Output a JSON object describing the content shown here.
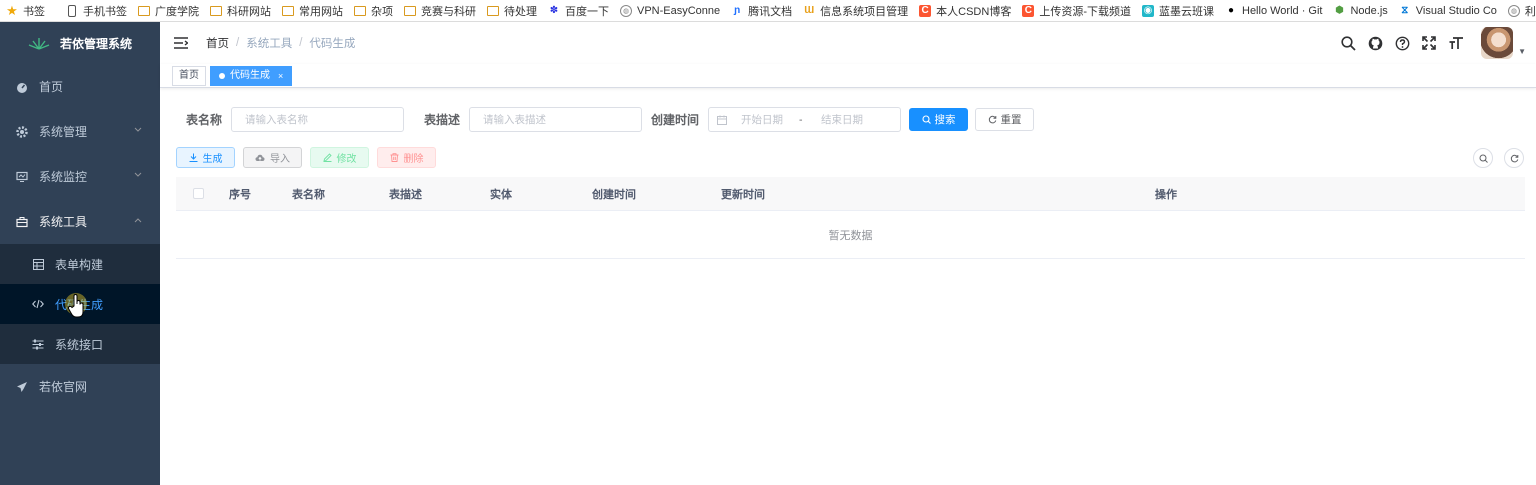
{
  "bookmarks": [
    {
      "label": "书签",
      "icon": "star-icon"
    },
    {
      "label": "手机书签",
      "icon": "phone-icon"
    },
    {
      "label": "广度学院",
      "icon": "folder-icon"
    },
    {
      "label": "科研网站",
      "icon": "folder-icon"
    },
    {
      "label": "常用网站",
      "icon": "folder-icon"
    },
    {
      "label": "杂项",
      "icon": "folder-icon"
    },
    {
      "label": "竞赛与科研",
      "icon": "folder-icon"
    },
    {
      "label": "待处理",
      "icon": "folder-icon"
    },
    {
      "label": "百度一下",
      "icon": "baidu-icon"
    },
    {
      "label": "VPN-EasyConne",
      "icon": "globe-icon"
    },
    {
      "label": "腾讯文档",
      "icon": "tencent-docs-icon"
    },
    {
      "label": "信息系统项目管理",
      "icon": "site-icon"
    },
    {
      "label": "本人CSDN博客",
      "icon": "csdn-icon"
    },
    {
      "label": "上传资源-下载频道",
      "icon": "csdn-icon"
    },
    {
      "label": "蓝墨云班课",
      "icon": "mosoteach-icon"
    },
    {
      "label": "Hello World · Git",
      "icon": "github-icon"
    },
    {
      "label": "Node.js",
      "icon": "nodejs-icon"
    },
    {
      "label": "Visual Studio Co",
      "icon": "vscode-icon"
    },
    {
      "label": "利用vscode调试",
      "icon": "globe-icon"
    }
  ],
  "sidebar": {
    "title": "若依管理系统",
    "items": [
      {
        "label": "首页",
        "icon": "dashboard-icon"
      },
      {
        "label": "系统管理",
        "icon": "gear-icon"
      },
      {
        "label": "系统监控",
        "icon": "monitor-icon"
      },
      {
        "label": "系统工具",
        "icon": "toolbox-icon"
      }
    ],
    "subitems": [
      {
        "label": "表单构建",
        "icon": "form-icon"
      },
      {
        "label": "代码生成",
        "icon": "code-icon"
      },
      {
        "label": "系统接口",
        "icon": "sliders-icon"
      }
    ],
    "last_item": {
      "label": "若依官网",
      "icon": "send-icon"
    }
  },
  "navbar": {
    "breadcrumb": [
      "首页",
      "系统工具",
      "代码生成"
    ],
    "icons": [
      "search-icon",
      "github-icon",
      "question-icon",
      "fullscreen-icon",
      "font-size-icon"
    ]
  },
  "tags": {
    "home": "首页",
    "active": "代码生成",
    "close": "×"
  },
  "search": {
    "table_name_label": "表名称",
    "table_name_placeholder": "请输入表名称",
    "table_desc_label": "表描述",
    "table_desc_placeholder": "请输入表描述",
    "create_time_label": "创建时间",
    "start_date": "开始日期",
    "date_sep": "-",
    "end_date": "结束日期",
    "search_btn": "搜索",
    "reset_btn": "重置"
  },
  "toolbar": {
    "generate": "生成",
    "import": "导入",
    "edit": "修改",
    "delete": "删除"
  },
  "table": {
    "columns": [
      "序号",
      "表名称",
      "表描述",
      "实体",
      "创建时间",
      "更新时间",
      "操作"
    ],
    "empty_text": "暂无数据"
  },
  "colors": {
    "sidebar_bg": "#304156",
    "submenu_bg": "#1f2d3d",
    "active_text": "#409eff",
    "primary": "#1890ff"
  }
}
